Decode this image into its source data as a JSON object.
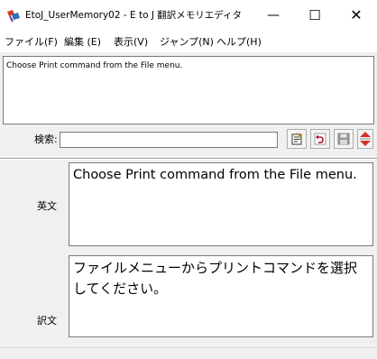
{
  "window": {
    "title": "EtoJ_UserMemory02 - E to J 翻訳メモリエディタ",
    "icon": "translation-memory-app-icon",
    "controls": {
      "minimize": "—",
      "maximize": "☐",
      "close": "✕"
    }
  },
  "menu": {
    "items": [
      "ファイル(F)",
      "編集 (E)",
      "表示(V)",
      "ジャンプ(N)",
      "ヘルプ(H)"
    ]
  },
  "source_list": {
    "text": "Choose Print command from the File menu."
  },
  "search": {
    "label": "検索:",
    "value": "",
    "buttons": [
      "new-entry-icon",
      "undo-icon",
      "save-icon",
      "spin-updown-icon"
    ]
  },
  "editor": {
    "english_label": "英文",
    "english_text": "Choose Print command from the File menu.",
    "japanese_label": "訳文",
    "japanese_text": "ファイルメニューからプリントコマンドを選択してください。"
  },
  "colors": {
    "window_bg": "#f0f0f0",
    "field_bg": "#ffffff",
    "border": "#7a7a7a"
  }
}
